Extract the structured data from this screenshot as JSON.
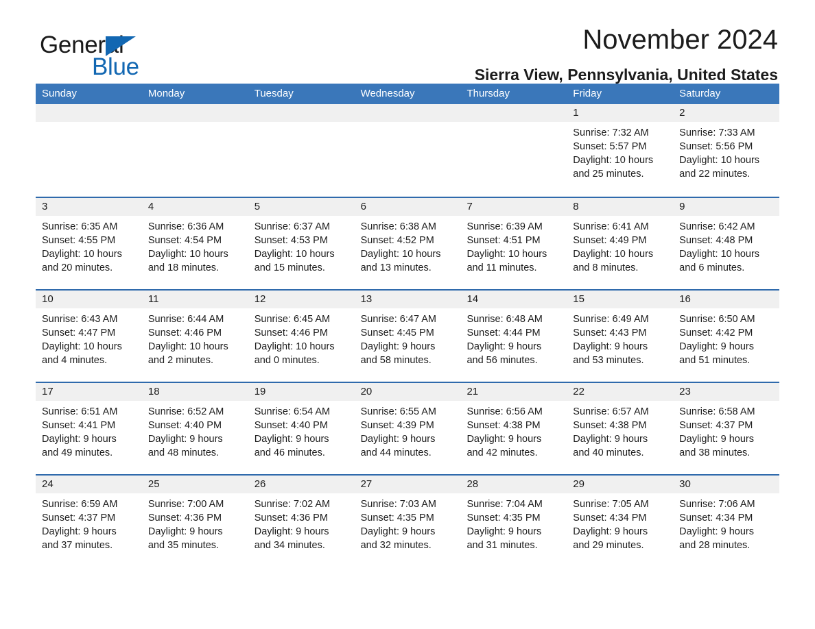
{
  "brand": {
    "name_part1": "General",
    "name_part2": "Blue",
    "accent_color": "#1267b2"
  },
  "header": {
    "title": "November 2024",
    "subtitle": "Sierra View, Pennsylvania, United States"
  },
  "theme": {
    "header_row_bg": "#3a77ba",
    "row_divider": "#2f6aac",
    "day_band_bg": "#f0f0f0",
    "text": "#1c1c1c"
  },
  "calendar": {
    "weekdays": [
      "Sunday",
      "Monday",
      "Tuesday",
      "Wednesday",
      "Thursday",
      "Friday",
      "Saturday"
    ],
    "labels": {
      "sunrise": "Sunrise:",
      "sunset": "Sunset:",
      "daylight": "Daylight:"
    },
    "weeks": [
      [
        {
          "day": "",
          "empty": true
        },
        {
          "day": "",
          "empty": true
        },
        {
          "day": "",
          "empty": true
        },
        {
          "day": "",
          "empty": true
        },
        {
          "day": "",
          "empty": true
        },
        {
          "day": "1",
          "sunrise": "Sunrise: 7:32 AM",
          "sunset": "Sunset: 5:57 PM",
          "daylight_line1": "Daylight: 10 hours",
          "daylight_line2": "and 25 minutes."
        },
        {
          "day": "2",
          "sunrise": "Sunrise: 7:33 AM",
          "sunset": "Sunset: 5:56 PM",
          "daylight_line1": "Daylight: 10 hours",
          "daylight_line2": "and 22 minutes."
        }
      ],
      [
        {
          "day": "3",
          "sunrise": "Sunrise: 6:35 AM",
          "sunset": "Sunset: 4:55 PM",
          "daylight_line1": "Daylight: 10 hours",
          "daylight_line2": "and 20 minutes."
        },
        {
          "day": "4",
          "sunrise": "Sunrise: 6:36 AM",
          "sunset": "Sunset: 4:54 PM",
          "daylight_line1": "Daylight: 10 hours",
          "daylight_line2": "and 18 minutes."
        },
        {
          "day": "5",
          "sunrise": "Sunrise: 6:37 AM",
          "sunset": "Sunset: 4:53 PM",
          "daylight_line1": "Daylight: 10 hours",
          "daylight_line2": "and 15 minutes."
        },
        {
          "day": "6",
          "sunrise": "Sunrise: 6:38 AM",
          "sunset": "Sunset: 4:52 PM",
          "daylight_line1": "Daylight: 10 hours",
          "daylight_line2": "and 13 minutes."
        },
        {
          "day": "7",
          "sunrise": "Sunrise: 6:39 AM",
          "sunset": "Sunset: 4:51 PM",
          "daylight_line1": "Daylight: 10 hours",
          "daylight_line2": "and 11 minutes."
        },
        {
          "day": "8",
          "sunrise": "Sunrise: 6:41 AM",
          "sunset": "Sunset: 4:49 PM",
          "daylight_line1": "Daylight: 10 hours",
          "daylight_line2": "and 8 minutes."
        },
        {
          "day": "9",
          "sunrise": "Sunrise: 6:42 AM",
          "sunset": "Sunset: 4:48 PM",
          "daylight_line1": "Daylight: 10 hours",
          "daylight_line2": "and 6 minutes."
        }
      ],
      [
        {
          "day": "10",
          "sunrise": "Sunrise: 6:43 AM",
          "sunset": "Sunset: 4:47 PM",
          "daylight_line1": "Daylight: 10 hours",
          "daylight_line2": "and 4 minutes."
        },
        {
          "day": "11",
          "sunrise": "Sunrise: 6:44 AM",
          "sunset": "Sunset: 4:46 PM",
          "daylight_line1": "Daylight: 10 hours",
          "daylight_line2": "and 2 minutes."
        },
        {
          "day": "12",
          "sunrise": "Sunrise: 6:45 AM",
          "sunset": "Sunset: 4:46 PM",
          "daylight_line1": "Daylight: 10 hours",
          "daylight_line2": "and 0 minutes."
        },
        {
          "day": "13",
          "sunrise": "Sunrise: 6:47 AM",
          "sunset": "Sunset: 4:45 PM",
          "daylight_line1": "Daylight: 9 hours",
          "daylight_line2": "and 58 minutes."
        },
        {
          "day": "14",
          "sunrise": "Sunrise: 6:48 AM",
          "sunset": "Sunset: 4:44 PM",
          "daylight_line1": "Daylight: 9 hours",
          "daylight_line2": "and 56 minutes."
        },
        {
          "day": "15",
          "sunrise": "Sunrise: 6:49 AM",
          "sunset": "Sunset: 4:43 PM",
          "daylight_line1": "Daylight: 9 hours",
          "daylight_line2": "and 53 minutes."
        },
        {
          "day": "16",
          "sunrise": "Sunrise: 6:50 AM",
          "sunset": "Sunset: 4:42 PM",
          "daylight_line1": "Daylight: 9 hours",
          "daylight_line2": "and 51 minutes."
        }
      ],
      [
        {
          "day": "17",
          "sunrise": "Sunrise: 6:51 AM",
          "sunset": "Sunset: 4:41 PM",
          "daylight_line1": "Daylight: 9 hours",
          "daylight_line2": "and 49 minutes."
        },
        {
          "day": "18",
          "sunrise": "Sunrise: 6:52 AM",
          "sunset": "Sunset: 4:40 PM",
          "daylight_line1": "Daylight: 9 hours",
          "daylight_line2": "and 48 minutes."
        },
        {
          "day": "19",
          "sunrise": "Sunrise: 6:54 AM",
          "sunset": "Sunset: 4:40 PM",
          "daylight_line1": "Daylight: 9 hours",
          "daylight_line2": "and 46 minutes."
        },
        {
          "day": "20",
          "sunrise": "Sunrise: 6:55 AM",
          "sunset": "Sunset: 4:39 PM",
          "daylight_line1": "Daylight: 9 hours",
          "daylight_line2": "and 44 minutes."
        },
        {
          "day": "21",
          "sunrise": "Sunrise: 6:56 AM",
          "sunset": "Sunset: 4:38 PM",
          "daylight_line1": "Daylight: 9 hours",
          "daylight_line2": "and 42 minutes."
        },
        {
          "day": "22",
          "sunrise": "Sunrise: 6:57 AM",
          "sunset": "Sunset: 4:38 PM",
          "daylight_line1": "Daylight: 9 hours",
          "daylight_line2": "and 40 minutes."
        },
        {
          "day": "23",
          "sunrise": "Sunrise: 6:58 AM",
          "sunset": "Sunset: 4:37 PM",
          "daylight_line1": "Daylight: 9 hours",
          "daylight_line2": "and 38 minutes."
        }
      ],
      [
        {
          "day": "24",
          "sunrise": "Sunrise: 6:59 AM",
          "sunset": "Sunset: 4:37 PM",
          "daylight_line1": "Daylight: 9 hours",
          "daylight_line2": "and 37 minutes."
        },
        {
          "day": "25",
          "sunrise": "Sunrise: 7:00 AM",
          "sunset": "Sunset: 4:36 PM",
          "daylight_line1": "Daylight: 9 hours",
          "daylight_line2": "and 35 minutes."
        },
        {
          "day": "26",
          "sunrise": "Sunrise: 7:02 AM",
          "sunset": "Sunset: 4:36 PM",
          "daylight_line1": "Daylight: 9 hours",
          "daylight_line2": "and 34 minutes."
        },
        {
          "day": "27",
          "sunrise": "Sunrise: 7:03 AM",
          "sunset": "Sunset: 4:35 PM",
          "daylight_line1": "Daylight: 9 hours",
          "daylight_line2": "and 32 minutes."
        },
        {
          "day": "28",
          "sunrise": "Sunrise: 7:04 AM",
          "sunset": "Sunset: 4:35 PM",
          "daylight_line1": "Daylight: 9 hours",
          "daylight_line2": "and 31 minutes."
        },
        {
          "day": "29",
          "sunrise": "Sunrise: 7:05 AM",
          "sunset": "Sunset: 4:34 PM",
          "daylight_line1": "Daylight: 9 hours",
          "daylight_line2": "and 29 minutes."
        },
        {
          "day": "30",
          "sunrise": "Sunrise: 7:06 AM",
          "sunset": "Sunset: 4:34 PM",
          "daylight_line1": "Daylight: 9 hours",
          "daylight_line2": "and 28 minutes."
        }
      ]
    ]
  }
}
